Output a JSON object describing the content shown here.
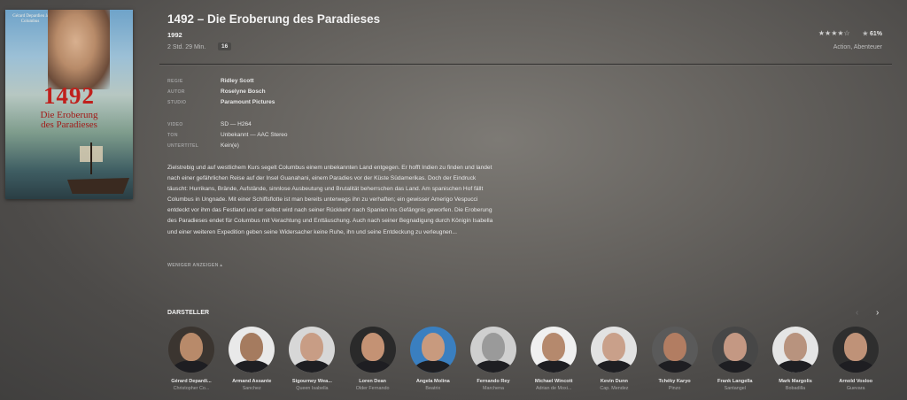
{
  "poster": {
    "credit": "Gérard Depardieu à Columbus",
    "year": "1492",
    "subtitle_line1": "Die Eroberung",
    "subtitle_line2": "des Paradieses"
  },
  "movie": {
    "title": "1492 – Die Eroberung des Paradieses",
    "year": "1992",
    "duration": "2 Std. 29 Min.",
    "age_rating": "16",
    "stars": "★★★★☆",
    "score": "61%",
    "genres": "Action, Abenteuer"
  },
  "meta": [
    {
      "key": "REGIE",
      "value": "Ridley Scott"
    },
    {
      "key": "AUTOR",
      "value": "Roselyne Bosch"
    },
    {
      "key": "STUDIO",
      "value": "Paramount Pictures"
    },
    {
      "key": "VIDEO",
      "value": "SD — H264"
    },
    {
      "key": "TON",
      "value": "Unbekannt — AAC Stereo"
    },
    {
      "key": "UNTERTITEL",
      "value": "Kein(e)"
    }
  ],
  "summary": "Zielstrebig und auf westlichem Kurs segelt Columbus einem unbekannten Land entgegen. Er hofft Indien zu finden und landet nach einer gefährlichen Reise auf der Insel Guanahani, einem Paradies vor der Küste Südamerikas. Doch der Eindruck täuscht: Hurrikans, Brände, Aufstände, sinnlose Ausbeutung und Brutalität beherrschen das Land. Am spanischen Hof fällt Columbus in Ungnade. Mit einer Schiffsflotte ist man bereits unterwegs ihn zu verhaften; ein gewisser Amerigo Vespucci entdeckt vor ihm das Festland und er selbst wird nach seiner Rückkehr nach Spanien ins Gefängnis geworfen. Die Eroberung des Paradieses endet für Columbus mit Verachtung und Enttäuschung. Auch nach seiner Begnadigung durch Königin Isabella und einer weiteren Expedition geben seine Widersacher keine Ruhe, ihn und seine Entdeckung zu verleugnen...",
  "less_label": "WENIGER ANZEIGEN ▴",
  "cast_heading": "DARSTELLER",
  "nav": {
    "prev": "‹",
    "next": "›"
  },
  "cast": [
    {
      "name": "Gérard Depardi...",
      "role": "Christopher Co...",
      "skin": "#b88a6a",
      "bg": "#3b3530"
    },
    {
      "name": "Armand Assante",
      "role": "Sanchez",
      "skin": "#a57b5f",
      "bg": "#e9e9e9"
    },
    {
      "name": "Sigourney Wea...",
      "role": "Queen Isabella",
      "skin": "#c89d85",
      "bg": "#d7d7d7"
    },
    {
      "name": "Loren Dean",
      "role": "Older Fernando",
      "skin": "#c49274",
      "bg": "#2a2a2a"
    },
    {
      "name": "Ángela Molina",
      "role": "Beatrix",
      "skin": "#c89a7e",
      "bg": "#3a7fc0"
    },
    {
      "name": "Fernando Rey",
      "role": "Marchena",
      "skin": "#9a9a9a",
      "bg": "#cfcfcf"
    },
    {
      "name": "Michael Wincott",
      "role": "Adrian de Moxi...",
      "skin": "#b5896d",
      "bg": "#f0f0f0"
    },
    {
      "name": "Kevin Dunn",
      "role": "Cap. Mendez",
      "skin": "#c9a08a",
      "bg": "#e2e2e2"
    },
    {
      "name": "Tchéky Karyo",
      "role": "Pinzo",
      "skin": "#b27d62",
      "bg": "#5a5a5a"
    },
    {
      "name": "Frank Langella",
      "role": "Santangel",
      "skin": "#c49883",
      "bg": "#474747"
    },
    {
      "name": "Mark Margolis",
      "role": "Bobadilla",
      "skin": "#b8937e",
      "bg": "#e5e5e5"
    },
    {
      "name": "Arnold Vosloo",
      "role": "Guevara",
      "skin": "#bf9278",
      "bg": "#2e2e2e"
    }
  ]
}
